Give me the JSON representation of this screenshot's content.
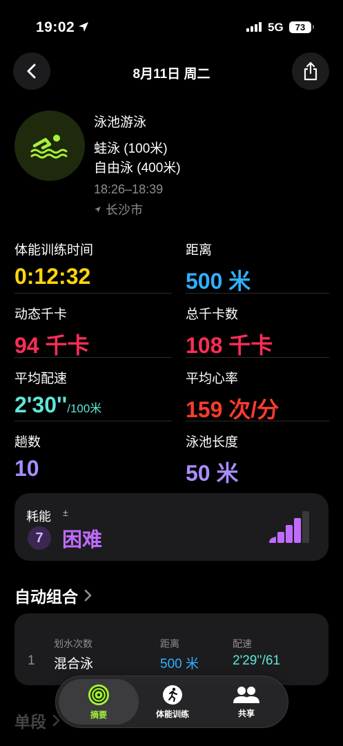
{
  "status_bar": {
    "time": "19:02",
    "network": "5G",
    "battery": "73"
  },
  "nav": {
    "title": "8月11日 周二"
  },
  "workout": {
    "name": "泳池游泳",
    "line1": "蛙泳 (100米)",
    "line2": "自由泳 (400米)",
    "time_range": "18:26–18:39",
    "location": "长沙市",
    "icon": "pool-swim-icon",
    "accent": "#a6f23a"
  },
  "metrics": [
    {
      "label": "体能训练时间",
      "value": "0:12:32",
      "unit": "",
      "color": "#ffd60a"
    },
    {
      "label": "距离",
      "value": "500",
      "unit": "米",
      "color": "#30b0ff"
    },
    {
      "label": "动态千卡",
      "value": "94",
      "unit": "千卡",
      "color": "#ff2d55"
    },
    {
      "label": "总千卡数",
      "value": "108",
      "unit": "千卡",
      "color": "#ff2d55"
    },
    {
      "label": "平均配速",
      "value": "2'30''",
      "unit": "/100米",
      "color": "#5ee7d8"
    },
    {
      "label": "平均心率",
      "value": "159",
      "unit": "次/分",
      "color": "#ff3b30"
    },
    {
      "label": "趟数",
      "value": "10",
      "unit": "",
      "color": "#a88dff"
    },
    {
      "label": "泳池长度",
      "value": "50",
      "unit": "米",
      "color": "#a88dff"
    }
  ],
  "effort": {
    "label": "耗能",
    "modifier": "±",
    "level": "7",
    "text": "困难",
    "color": "#bf6bff"
  },
  "auto_sets": {
    "title": "自动组合",
    "headers": {
      "stroke": "划水次数",
      "distance": "距离",
      "pace": "配速"
    },
    "rows": [
      {
        "index": "1",
        "stroke": "混合泳",
        "distance": "500 米",
        "pace": "2'29''/61"
      }
    ]
  },
  "next_section": {
    "title": "单段"
  },
  "tabbar": {
    "tabs": [
      {
        "label": "摘要",
        "icon": "summary-rings-icon",
        "active": true
      },
      {
        "label": "体能训练",
        "icon": "workout-runner-icon",
        "active": false
      },
      {
        "label": "共享",
        "icon": "sharing-people-icon",
        "active": false
      }
    ]
  }
}
